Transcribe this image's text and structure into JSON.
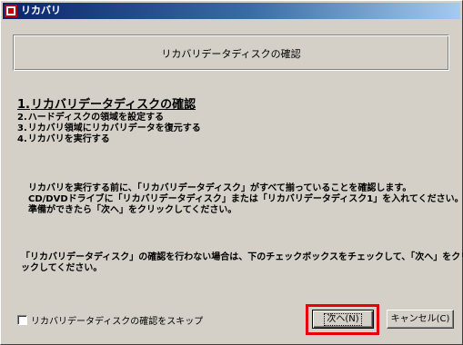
{
  "window": {
    "title": "リカバリ"
  },
  "header": {
    "title": "リカバリデータディスクの確認"
  },
  "steps": [
    {
      "num": "1.",
      "label": "リカバリデータディスクの確認"
    },
    {
      "num": "2.",
      "label": "ハードディスクの領域を設定する"
    },
    {
      "num": "3.",
      "label": "リカバリ領域にリカバリデータを復元する"
    },
    {
      "num": "4.",
      "label": "リカバリを実行する"
    }
  ],
  "instructions": [
    "リカバリを実行する前に、「リカバリデータディスク」がすべて揃っていることを確認します。",
    "CD/DVDドライブに「リカバリデータディスク」または「リカバリデータディスク1」を入れてください。",
    "準備ができたら「次へ」をクリックしてください。"
  ],
  "skip_note": [
    "「リカバリデータディスク」の確認を行わない場合は、下のチェックボックスをチェックして、「次へ」をクリ",
    "ックしてください。"
  ],
  "checkbox": {
    "label": "リカバリデータディスクの確認をスキップ",
    "checked": false
  },
  "buttons": {
    "next": "次へ(N)",
    "cancel": "キャンセル(C)"
  },
  "colors": {
    "highlight": "#e8000b",
    "titlebar_start": "#0a246a",
    "titlebar_end": "#a6caf0"
  },
  "icons": {
    "app": "recovery-app-icon"
  }
}
